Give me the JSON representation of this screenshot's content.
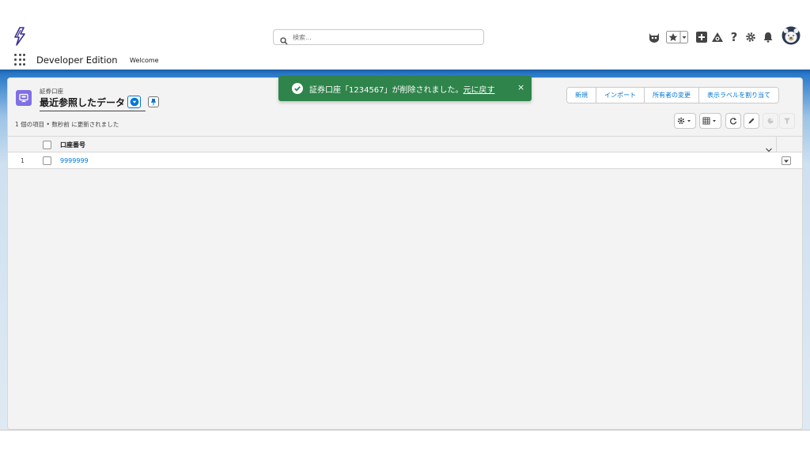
{
  "header": {
    "search_placeholder": "検索...",
    "app_name": "Developer Edition",
    "nav_items": [
      "Welcome"
    ]
  },
  "list_view": {
    "object_label": "証券口座",
    "title": "最近参照したデータ",
    "status": "1 個の項目 • 数秒前 に更新されました",
    "actions": [
      "新規",
      "インポート",
      "所有者の変更",
      "表示ラベルを割り当て"
    ]
  },
  "table": {
    "columns": [
      "口座番号"
    ],
    "rows": [
      {
        "num": "1",
        "account_number": "9999999"
      }
    ]
  },
  "toast": {
    "message": "証券口座「1234567」が削除されました。",
    "undo_label": "元に戻す",
    "close": "×",
    "color": "#2e844a"
  },
  "colors": {
    "brand": "#0176d3",
    "object_icon": "#7f70e5"
  }
}
